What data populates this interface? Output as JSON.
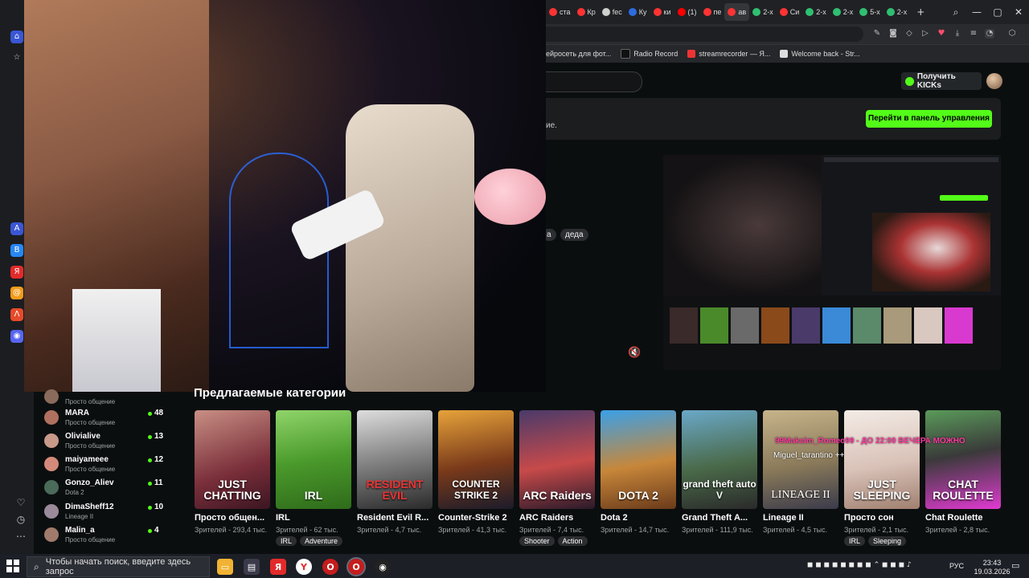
{
  "browser": {
    "tabs": [
      {
        "label": "ста",
        "color": "#ff3333"
      },
      {
        "label": "Кр",
        "color": "#ff3333"
      },
      {
        "label": "fec",
        "color": "#cfcfcf"
      },
      {
        "label": "Ку",
        "color": "#2d6cdf"
      },
      {
        "label": "ки",
        "color": "#ff3333"
      },
      {
        "label": "(1)",
        "color": "#ff0000"
      },
      {
        "label": "пе",
        "color": "#ff3333"
      },
      {
        "label": "ав",
        "color": "#ff3333"
      },
      {
        "label": "2-х",
        "color": "#2fbf71"
      },
      {
        "label": "Си",
        "color": "#ff3333"
      },
      {
        "label": "2-х",
        "color": "#2fbf71"
      },
      {
        "label": "2-х",
        "color": "#2fbf71"
      },
      {
        "label": "5-х",
        "color": "#2fbf71"
      },
      {
        "label": "2-х",
        "color": "#2fbf71"
      }
    ],
    "bookmarks": [
      {
        "label": "ейросеть для фот..."
      },
      {
        "label": "Radio Record"
      },
      {
        "label": "streamrecorder — Я..."
      },
      {
        "label": "Welcome back - Str..."
      }
    ]
  },
  "kick": {
    "kicks_button": "Получить KICKs",
    "banner_text": "ие.",
    "panel_button": "Перейти в панель управления",
    "stream_tags": [
      "a",
      "деда"
    ],
    "categories_title": "Предлагаемые категории",
    "followed": [
      {
        "name": "",
        "subtitle": "Просто общение",
        "count": "",
        "color": "#8a6a5a"
      },
      {
        "name": "MARA",
        "subtitle": "Просто общение",
        "count": "48",
        "color": "#b07060"
      },
      {
        "name": "Olivialive",
        "subtitle": "Просто общение",
        "count": "13",
        "color": "#c79a8a"
      },
      {
        "name": "maiyameee",
        "subtitle": "Просто общение",
        "count": "12",
        "color": "#d48a7a"
      },
      {
        "name": "Gonzo_Aliev",
        "subtitle": "Dota 2",
        "count": "11",
        "color": "#4a6a5a"
      },
      {
        "name": "DimaSheff12",
        "subtitle": "Lineage II",
        "count": "10",
        "color": "#9a8a9a"
      },
      {
        "name": "Malin_a",
        "subtitle": "Просто общение",
        "count": "4",
        "color": "#a07a6a"
      }
    ],
    "categories": [
      {
        "name": "Просто общен...",
        "viewers": "Зрителей - 293,4 тыс.",
        "logo": "JUST CHATTING",
        "bg": "linear-gradient(160deg,#c98f84,#7a2f3a 60%,#3b1522)",
        "tags": []
      },
      {
        "name": "IRL",
        "viewers": "Зрителей - 62 тыс.",
        "logo": "IRL",
        "bg": "linear-gradient(170deg,#8fd46a,#4b9a2c 50%,#2e6b1a)",
        "tags": [
          "IRL",
          "Adventure"
        ]
      },
      {
        "name": "Resident Evil R...",
        "viewers": "Зрителей - 4,7 тыс.",
        "logo": "RESIDENT EVIL",
        "bg": "linear-gradient(170deg,#ddd,#8a8a8a 45%,#2a2a2a)",
        "tags": []
      },
      {
        "name": "Counter-Strike 2",
        "viewers": "Зрителей - 41,3 тыс.",
        "logo": "COUNTER STRIKE 2",
        "bg": "linear-gradient(170deg,#e7a33a,#7a3a1a 55%,#1b1b2a)",
        "tags": []
      },
      {
        "name": "ARC Raiders",
        "viewers": "Зрителей - 7,4 тыс.",
        "logo": "ARC Raiders",
        "bg": "linear-gradient(170deg,#4a3a6a,#c74a4a 55%,#2a1a2a)",
        "tags": [
          "Shooter",
          "Action"
        ]
      },
      {
        "name": "Dota 2",
        "viewers": "Зрителей - 14,7 тыс.",
        "logo": "DOTA 2",
        "bg": "linear-gradient(170deg,#3aa0e8,#c7873a 55%,#6a3a1a)",
        "tags": []
      },
      {
        "name": "Grand Theft A...",
        "viewers": "Зрителей - 111,9 тыс.",
        "logo": "grand theft auto V",
        "bg": "linear-gradient(170deg,#6aa8c8,#4a6a4a 55%,#2a2a2a)",
        "tags": []
      },
      {
        "name": "Lineage II",
        "viewers": "Зрителей - 4,5 тыс.",
        "logo": "LINEAGE II",
        "bg": "linear-gradient(170deg,#c7b48a,#8a7a5a 55%,#3a3a4a)",
        "tags": []
      },
      {
        "name": "Просто сон",
        "viewers": "Зрителей - 2,1 тыс.",
        "logo": "JUST SLEEPING",
        "bg": "linear-gradient(170deg,#f3ece6,#d9c2b8 55%,#a08070)",
        "tags": [
          "IRL",
          "Sleeping"
        ]
      },
      {
        "name": "Chat Roulette",
        "viewers": "Зрителей - 2,8 тыс.",
        "logo": "CHAT ROULETTE",
        "bg": "linear-gradient(170deg,#5a9a5a,#3a3a3a 45%,#e03ad0)",
        "tags": []
      }
    ]
  },
  "overlay": {
    "line1": "99Maksim_Romeo99 - ДО 22:00 ВЕЧЕРА МОЖНО",
    "line2": "Miguel_tarantino ++"
  },
  "taskbar": {
    "search_placeholder": "Чтобы начать поиск, введите здесь запрос",
    "lang": "РУС",
    "time": "23:43",
    "date": "19.03.2026"
  },
  "colors": {
    "kick_green": "#53fc18",
    "bg": "#0b0e0f"
  }
}
